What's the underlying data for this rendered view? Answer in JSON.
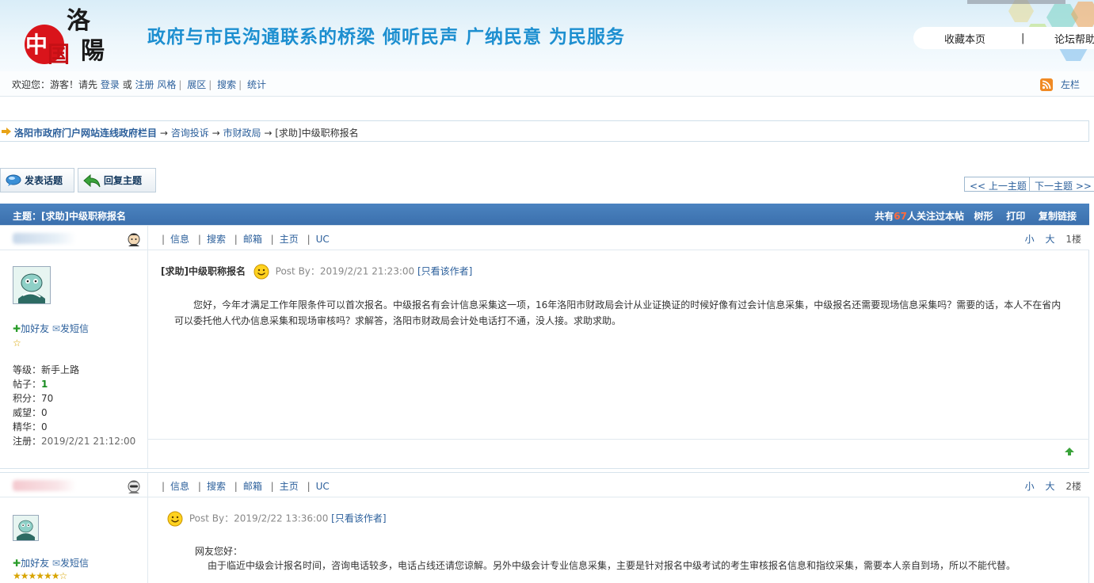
{
  "header": {
    "logo_text": "中国洛阳",
    "slogan": "政府与市民沟通联系的桥梁  倾听民声  广纳民意  为民服务",
    "bookmark_label": "收藏本页",
    "divider": "|",
    "help_label": "论坛帮助"
  },
  "welcome": {
    "greeting": "欢迎您：游客！请先",
    "login": "登录",
    "or": "或",
    "register": "注册",
    "style": "风格",
    "expand": "展区",
    "search": "搜索",
    "stats": "统计",
    "left_col": "左栏"
  },
  "breadcrumb": {
    "root": "洛阳市政府门户网站连线政府栏目",
    "arrow": "→",
    "level2": "咨询投诉",
    "level3": "市财政局",
    "current": "[求助]中级职称报名"
  },
  "actions": {
    "new_topic": "发表话题",
    "reply": "回复主题",
    "prev": "<< 上一主题",
    "next": "下一主题 >>"
  },
  "topic": {
    "label": "主题：[求助]中级职称报名",
    "watch_prefix": "共有",
    "watch_count": "67",
    "watch_suffix": "人关注过本帖",
    "tree": "树形",
    "print": "打印",
    "copy": "复制链接"
  },
  "post_links": {
    "info": "信息",
    "search": "搜索",
    "mail": "邮箱",
    "home": "主页",
    "uc": "UC",
    "small": "小",
    "big": "大",
    "pipe": "|"
  },
  "posts": [
    {
      "floor": "1楼",
      "add_friend": "加好友",
      "send_msg": "发短信",
      "stars": "☆",
      "level_label": "等级：",
      "level": "新手上路",
      "posts_label": "帖子：",
      "posts": "1",
      "score_label": "积分：",
      "score": "70",
      "prestige_label": "威望：",
      "prestige": "0",
      "elite_label": "精华：",
      "elite": "0",
      "reg_label": "注册：",
      "reg": "2019/2/21 21:12:00",
      "title": "[求助]中级职称报名",
      "post_by": "Post By：2019/2/21 21:23:00",
      "author_only": "[只看该作者]",
      "content": "您好，今年才满足工作年限条件可以首次报名。中级报名有会计信息采集这一项，16年洛阳市财政局会计从业证换证的时候好像有过会计信息采集，中级报名还需要现场信息采集吗？需要的话，本人不在省内可以委托他人代办信息采集和现场审核吗？求解答，洛阳市财政局会计处电话打不通，没人接。求助求助。"
    },
    {
      "floor": "2楼",
      "add_friend": "加好友",
      "send_msg": "发短信",
      "stars": "★★★★★★☆",
      "post_by": "Post By：2019/2/22 13:36:00",
      "author_only": "[只看该作者]",
      "greeting": "网友您好：",
      "content": "由于临近中级会计报名时间，咨询电话较多，电话占线还请您谅解。另外中级会计专业信息采集，主要是针对报名中级考试的考生审核报名信息和指纹采集，需要本人亲自到场，所以不能代替。"
    }
  ],
  "colors": {
    "slogan": "#1d8fd0",
    "topic_bar": "#3b70ad",
    "link": "#2b5f9b",
    "watch_count": "#ff6a3c"
  }
}
